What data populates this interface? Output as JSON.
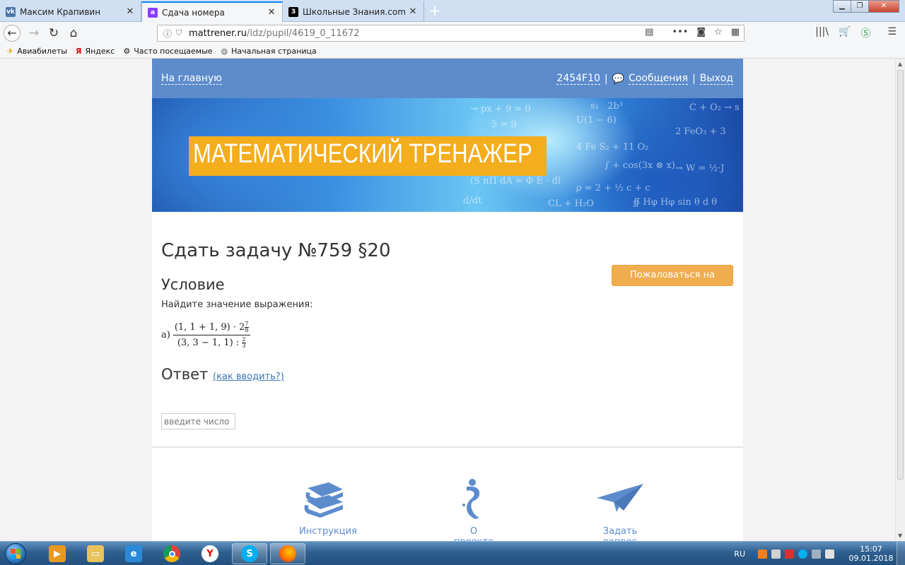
{
  "browser": {
    "tabs": [
      {
        "title": "Максим Крапивин",
        "favicon": "vk-icon",
        "color": "#4a76a8"
      },
      {
        "title": "Сдача номера",
        "favicon": "yandex-a-icon",
        "color": "#8a3ffc"
      },
      {
        "title": "Школьные Знания.com - Реш",
        "favicon": "znanija-icon",
        "color": "#000000"
      }
    ],
    "url": {
      "host": "mattrener.ru",
      "path": "/idz/pupil/4619_0_11672"
    },
    "bookmarks": [
      {
        "label": "Авиабилеты",
        "icon": "plane-icon"
      },
      {
        "label": "Яндекс",
        "icon": "yandex-icon"
      },
      {
        "label": "Часто посещаемые",
        "icon": "gear-icon"
      },
      {
        "label": "Начальная страница",
        "icon": "globe-icon"
      }
    ]
  },
  "site": {
    "nav": {
      "home": "На главную",
      "user_id": "2454F10",
      "messages": "Сообщения",
      "logout": "Выход",
      "separator": "|"
    },
    "banner_title": "МАТЕМАТИЧЕСКИЙ ТРЕНАЖЕР",
    "task_title": "Сдать задачу №759 §20",
    "complain_button": "Пожаловаться на задачу",
    "condition_heading": "Условие",
    "condition_text": "Найдите значение выражения:",
    "expression": {
      "label": "а)",
      "numerator": "(1, 1 + 1, 9) · 2",
      "numerator_mixed": {
        "num": "7",
        "den": "8"
      },
      "denominator": "(3, 3 − 1, 1) : ",
      "denominator_frac": {
        "num": "2",
        "den": "3"
      }
    },
    "answer_heading": "Ответ",
    "answer_help": "(как вводить?)",
    "answer_placeholder": "введите число",
    "footer": [
      {
        "label": "Инструкция",
        "icon": "books-icon"
      },
      {
        "label": "О проекте",
        "icon": "info-icon"
      },
      {
        "label": "Задать вопрос",
        "icon": "paper-plane-icon"
      }
    ]
  },
  "taskbar": {
    "lang": "RU",
    "time": "15:07",
    "date": "09.01.2018"
  }
}
